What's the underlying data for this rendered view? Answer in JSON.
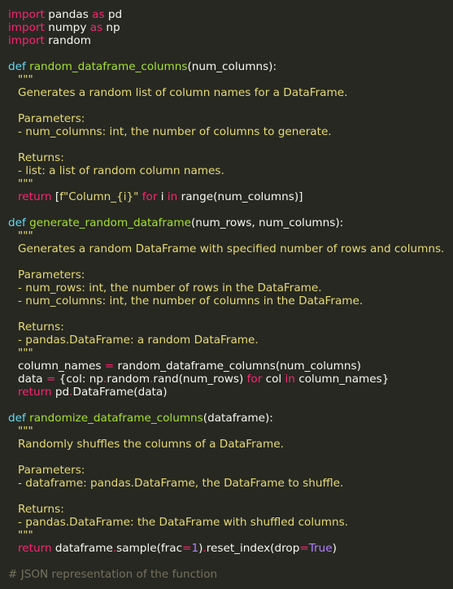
{
  "editor": {
    "colors": {
      "background": "#272822",
      "text": "#f8f8f2",
      "keyword_import": "#f92672",
      "keyword_def": "#66d9ef",
      "function_name": "#a6e22e",
      "string_docstring": "#e6db74",
      "number": "#ae81ff",
      "comment": "#75715e"
    },
    "code": {
      "imports": [
        {
          "kw": "import",
          "mod": " pandas ",
          "as": "as",
          "alias": " pd"
        },
        {
          "kw": "import",
          "mod": " numpy ",
          "as": "as",
          "alias": " np"
        },
        {
          "kw": "import",
          "mod": " random",
          "as": "",
          "alias": ""
        }
      ],
      "f1": {
        "def": "def ",
        "name": "random_dataframe_columns",
        "args": "(num_columns):",
        "doc_open": "\"\"\"",
        "doc_summary": "Generates a random list of column names for a DataFrame.",
        "params_label": "Parameters:",
        "param1": "- num_columns: int, the number of columns to generate.",
        "returns_label": "Returns:",
        "ret1": "- list: a list of random column names.",
        "doc_close": "\"\"\"",
        "ret_kw": "return ",
        "ret_pre": "[",
        "ret_fstr": "f\"Column_{i}\"",
        "ret_for": " for ",
        "ret_i": "i ",
        "ret_in": "in",
        "ret_post": " range(num_columns)]"
      },
      "f2": {
        "def": "def ",
        "name": "generate_random_dataframe",
        "args": "(num_rows, num_columns):",
        "doc_open": "\"\"\"",
        "doc_summary": "Generates a random DataFrame with specified number of rows and columns.",
        "params_label": "Parameters:",
        "param1": "- num_rows: int, the number of rows in the DataFrame.",
        "param2": "- num_columns: int, the number of columns in the DataFrame.",
        "returns_label": "Returns:",
        "ret1": "- pandas.DataFrame: a random DataFrame.",
        "doc_close": "\"\"\"",
        "l1_a": "column_names ",
        "l1_eq": "=",
        "l1_b": " random_dataframe_columns(num_columns)",
        "l2_a": "data ",
        "l2_eq": "=",
        "l2_b": " {col: np",
        "l2_dot1": ".",
        "l2_c": "random",
        "l2_dot2": ".",
        "l2_d": "rand(num_rows) ",
        "l2_for": "for",
        "l2_e": " col ",
        "l2_in": "in",
        "l2_f": " column_names}",
        "l3_kw": "return ",
        "l3_a": "pd",
        "l3_dot": ".",
        "l3_b": "DataFrame(data)"
      },
      "f3": {
        "def": "def ",
        "name": "randomize_dataframe_columns",
        "args": "(dataframe):",
        "doc_open": "\"\"\"",
        "doc_summary": "Randomly shuffles the columns of a DataFrame.",
        "params_label": "Parameters:",
        "param1": "- dataframe: pandas.DataFrame, the DataFrame to shuffle.",
        "returns_label": "Returns:",
        "ret1": "- pandas.DataFrame: the DataFrame with shuffled columns.",
        "doc_close": "\"\"\"",
        "ret_kw": "return ",
        "ret_a": "dataframe",
        "ret_dot1": ".",
        "ret_b": "sample(frac",
        "ret_eq1": "=",
        "ret_num": "1",
        "ret_c": ")",
        "ret_dot2": ".",
        "ret_d": "reset_index(drop",
        "ret_eq2": "=",
        "ret_true": "True",
        "ret_e": ")"
      },
      "comment": "# JSON representation of the function"
    }
  }
}
